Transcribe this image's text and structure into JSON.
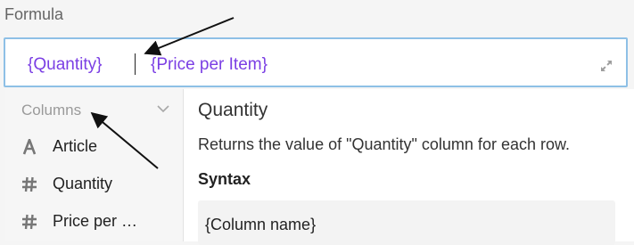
{
  "field": {
    "label": "Formula"
  },
  "formula": {
    "tokens": [
      "{Quantity}",
      "{Price per Item}"
    ],
    "expand_icon": "expand-icon"
  },
  "columns": {
    "header": "Columns",
    "items": [
      {
        "label": "Article",
        "icon": "text-type-icon"
      },
      {
        "label": "Quantity",
        "icon": "number-type-icon"
      },
      {
        "label": "Price per …",
        "icon": "number-type-icon"
      }
    ]
  },
  "detail": {
    "title": "Quantity",
    "description": "Returns the value of \"Quantity\" column for each row.",
    "syntax_label": "Syntax",
    "syntax_example": "{Column name}"
  },
  "colors": {
    "token": "#7b3fe4",
    "focus_border": "#8ec0e6",
    "panel_bg": "#f6f6f6"
  }
}
